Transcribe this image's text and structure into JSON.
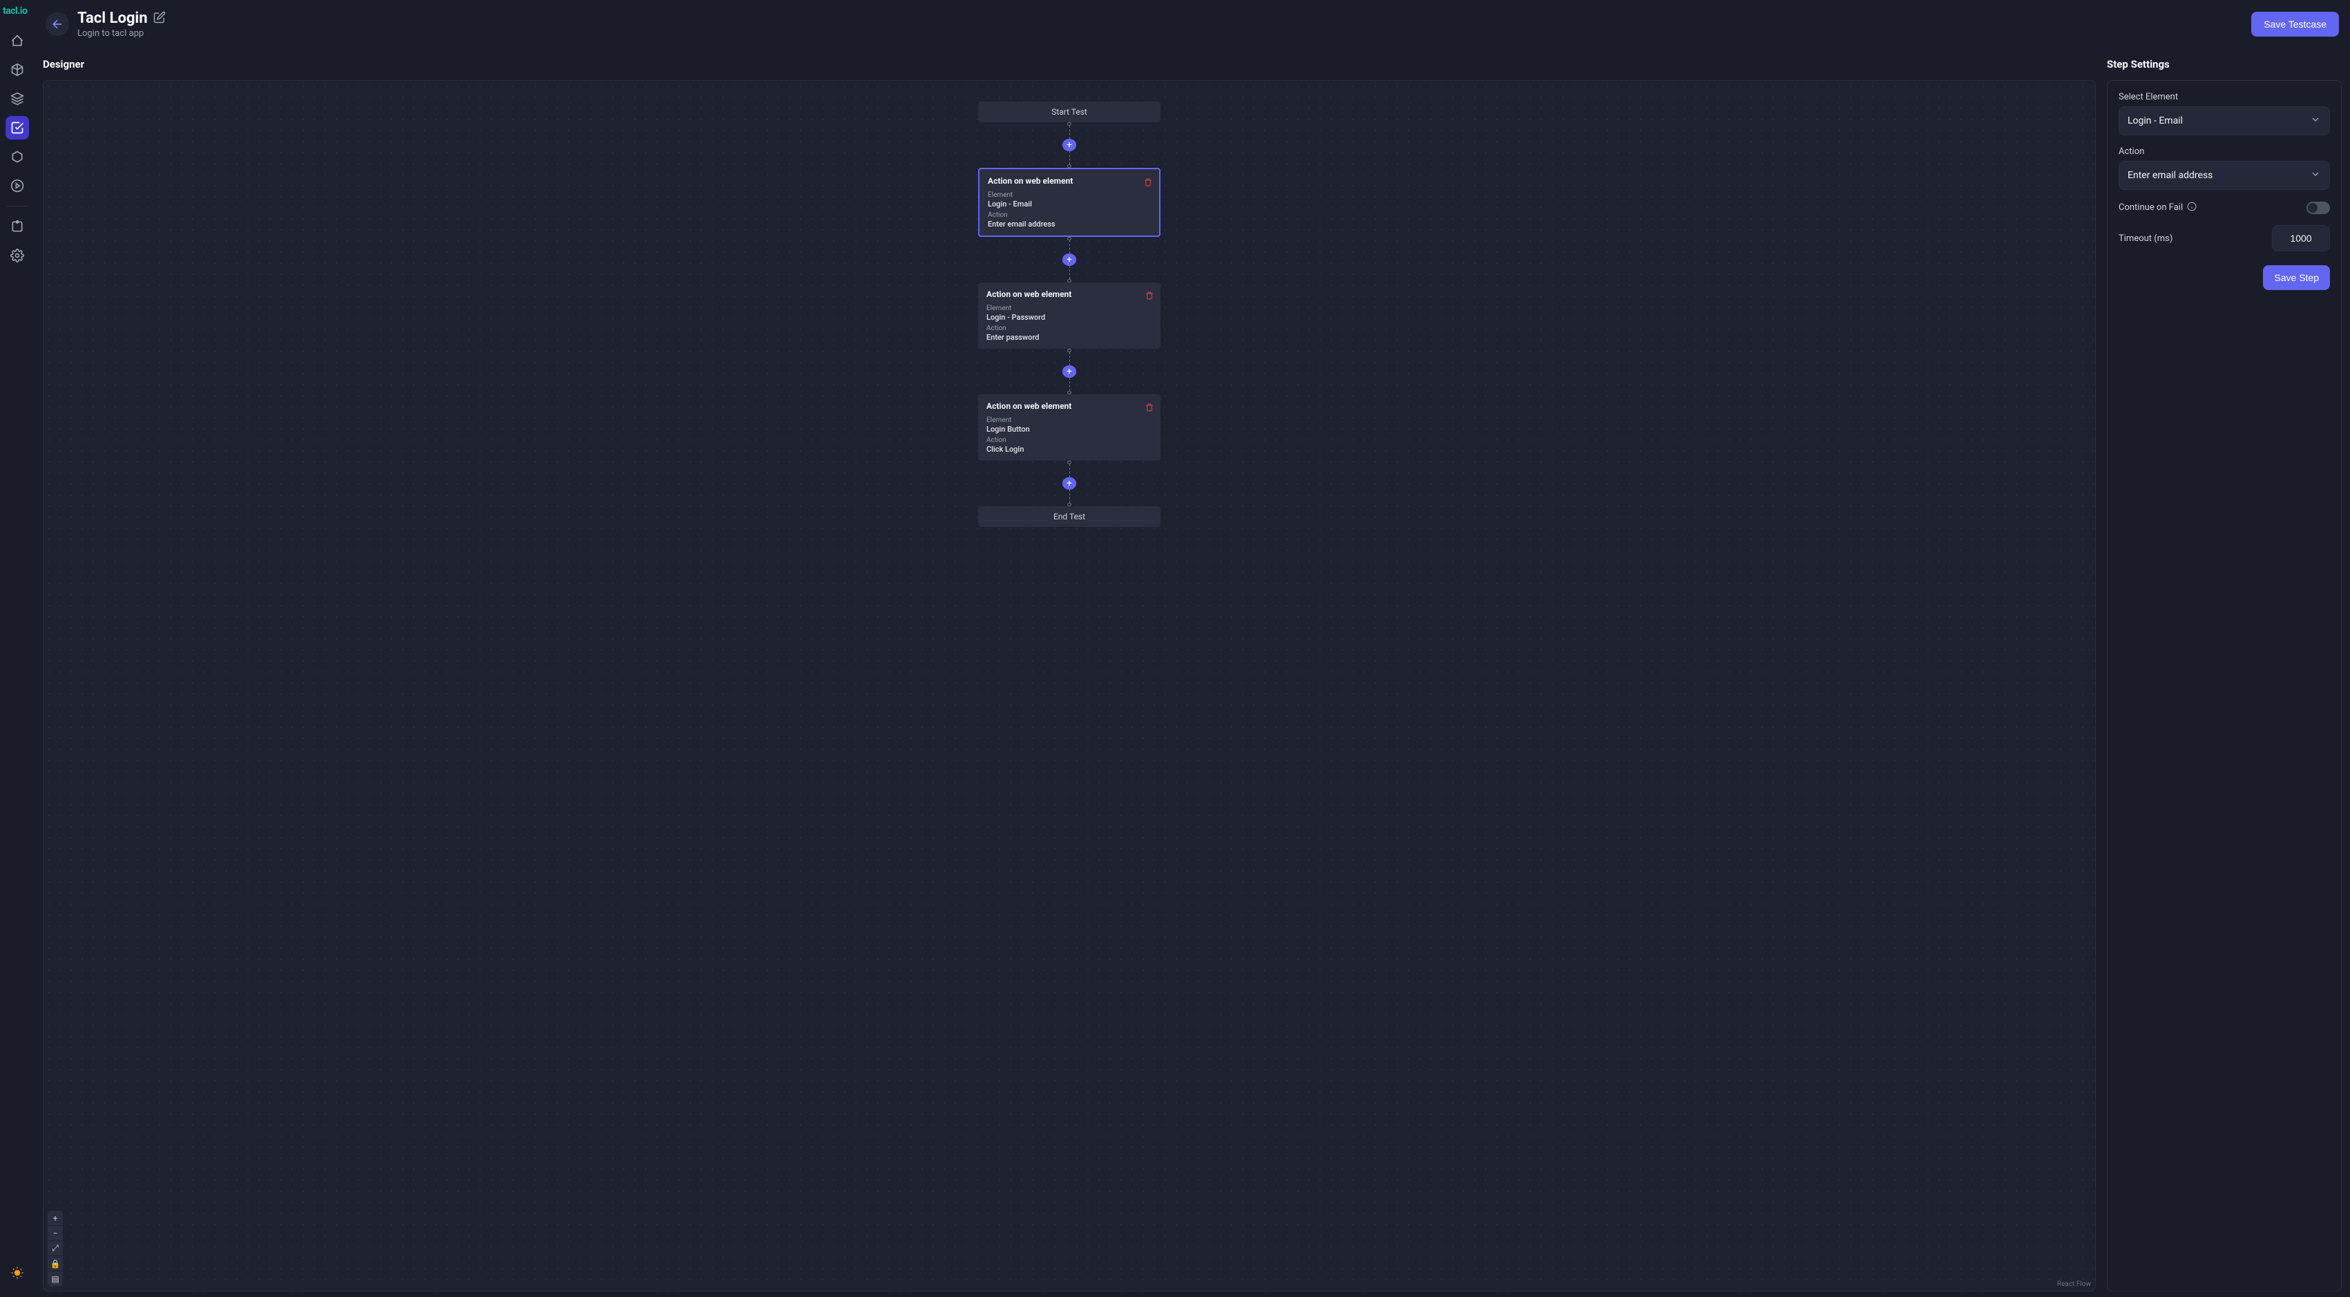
{
  "brand": "tacl.io",
  "header": {
    "title": "Tacl Login",
    "subtitle": "Login to tacl app",
    "save_button_label": "Save Testcase"
  },
  "sidebar": {
    "items": [
      {
        "name": "home"
      },
      {
        "name": "box"
      },
      {
        "name": "layers"
      },
      {
        "name": "document",
        "active": true
      },
      {
        "name": "package"
      },
      {
        "name": "play"
      },
      {
        "name": "extensions"
      },
      {
        "name": "settings"
      }
    ],
    "bottom": {
      "name": "theme"
    }
  },
  "designer": {
    "title": "Designer",
    "start_label": "Start Test",
    "end_label": "End Test",
    "attribution": "React Flow",
    "steps": [
      {
        "title": "Action on web element",
        "element_label": "Element",
        "element_value": "Login - Email",
        "action_label": "Action",
        "action_value": "Enter email address",
        "selected": true
      },
      {
        "title": "Action on web element",
        "element_label": "Element",
        "element_value": "Login - Password",
        "action_label": "Action",
        "action_value": "Enter password",
        "selected": false
      },
      {
        "title": "Action on web element",
        "element_label": "Element",
        "element_value": "Login Button",
        "action_label": "Action",
        "action_value": "Click Login",
        "selected": false
      }
    ]
  },
  "settings": {
    "title": "Step Settings",
    "select_element_label": "Select Element",
    "select_element_value": "Login - Email",
    "action_label": "Action",
    "action_value": "Enter email address",
    "continue_on_fail_label": "Continue on Fail",
    "continue_on_fail_value": false,
    "timeout_label": "Timeout (ms)",
    "timeout_value": "1000",
    "save_step_label": "Save Step"
  }
}
